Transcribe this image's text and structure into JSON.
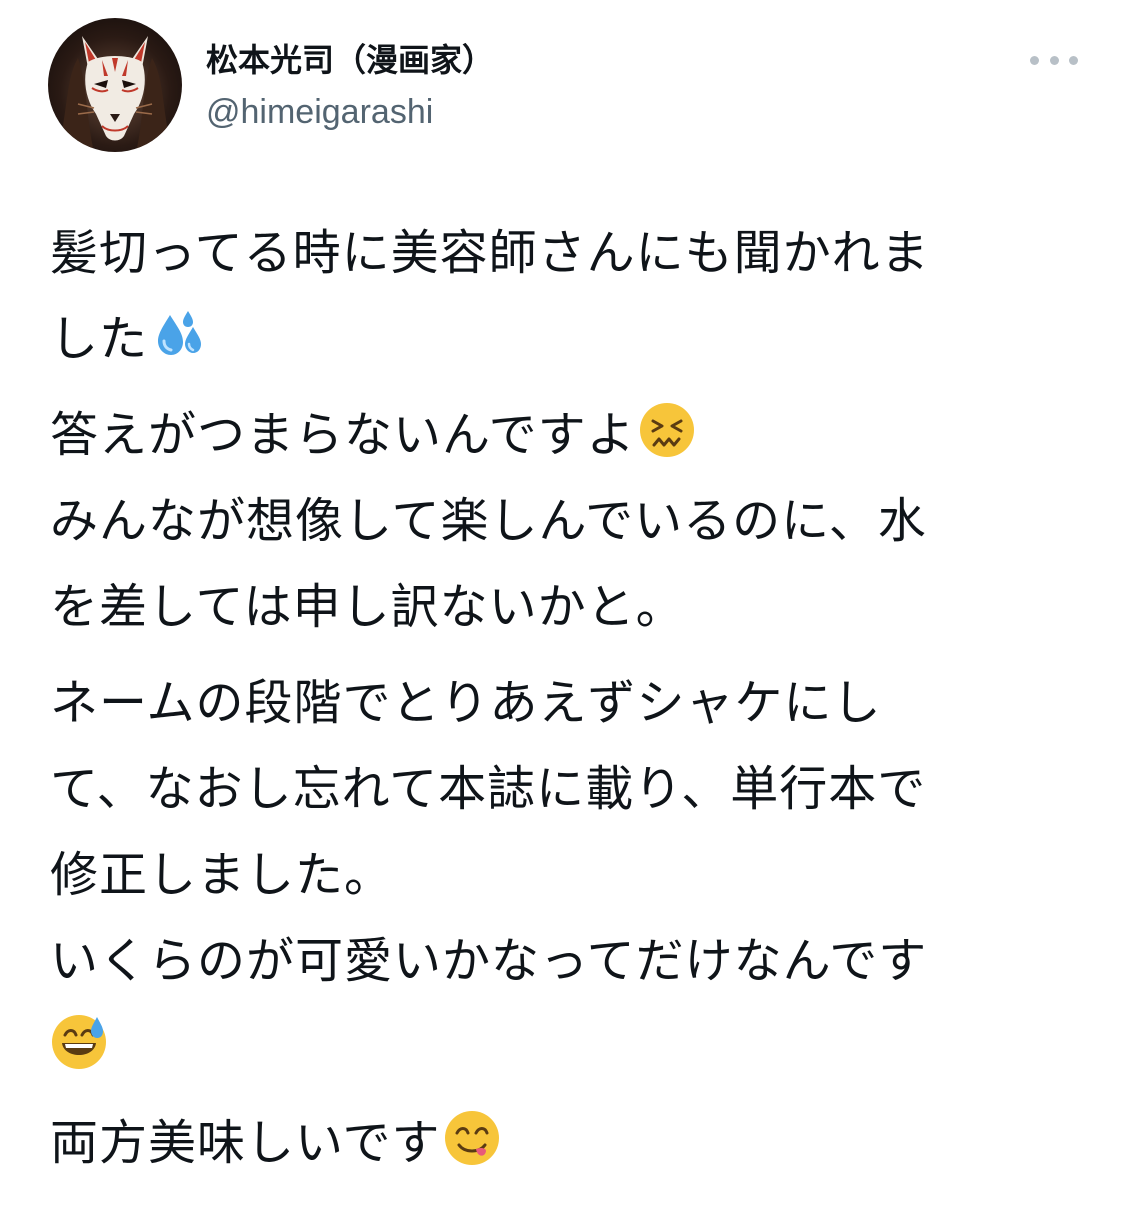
{
  "author": {
    "display_name": "松本光司（漫画家）",
    "handle": "@himeigarashi"
  },
  "tweet": {
    "lines": [
      "髪切ってる時に美容師さんにも聞かれま",
      "した",
      "答えがつまらないんですよ",
      "みんなが想像して楽しんでいるのに、水",
      "を差しては申し訳ないかと。",
      "ネームの段階でとりあえずシャケにし",
      "て、なおし忘れて本誌に載り、単行本で",
      "修正しました。",
      "いくらのが可愛いかなってだけなんです",
      "両方美味しいです"
    ]
  },
  "icons": {
    "more": "more-horizontal-icon",
    "avatar": "kitsune-mask-avatar",
    "emoji_1": "sweat-droplets-emoji",
    "emoji_2": "confounded-face-emoji",
    "emoji_3": "grinning-sweat-face-emoji",
    "emoji_4": "yum-face-emoji"
  },
  "colors": {
    "text": "#0f1419",
    "secondary": "#536471",
    "more_dots": "#b8c0c7",
    "emoji_yellow": "#f7c53a",
    "droplet_blue": "#4aa3e8"
  }
}
